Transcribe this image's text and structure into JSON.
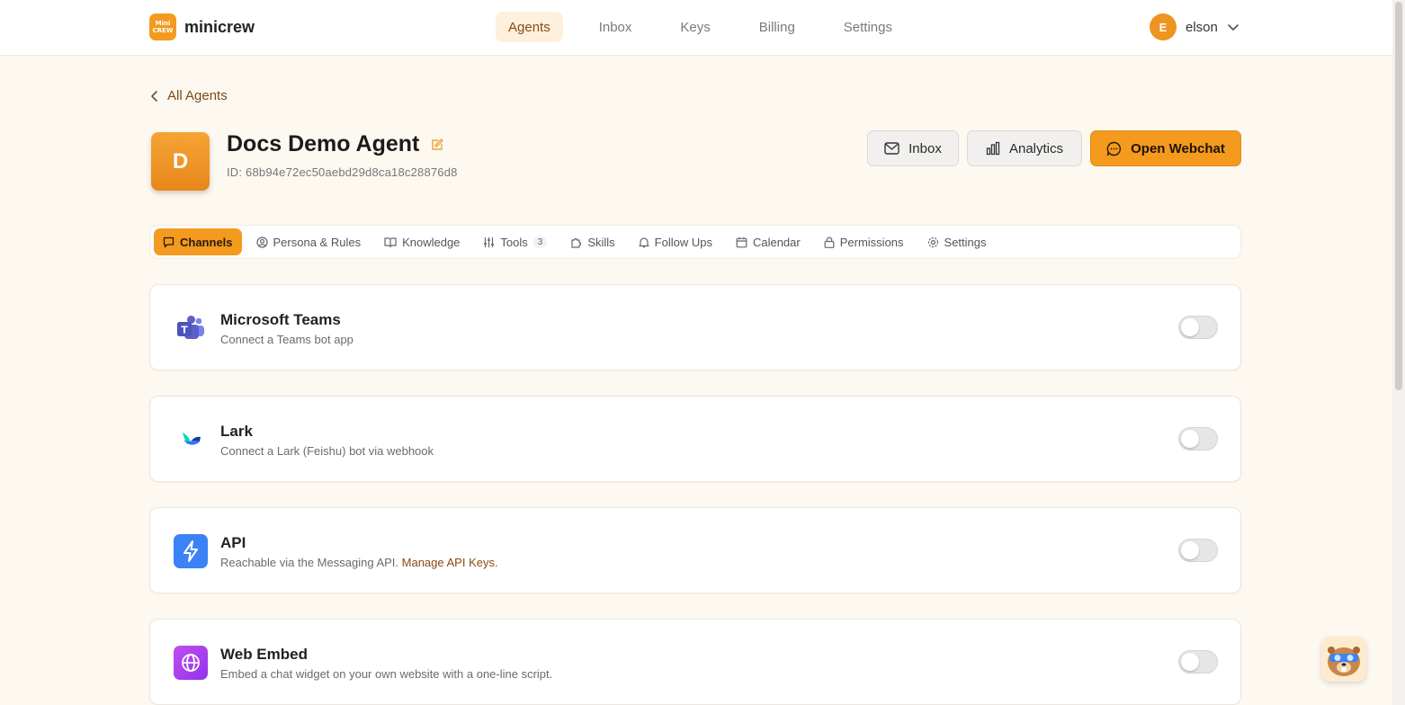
{
  "app": {
    "logo_mark_top": "Mini",
    "logo_mark_bottom": "CREW",
    "name": "minicrew"
  },
  "nav": {
    "items": [
      {
        "label": "Agents",
        "active": true
      },
      {
        "label": "Inbox"
      },
      {
        "label": "Keys"
      },
      {
        "label": "Billing"
      },
      {
        "label": "Settings"
      }
    ]
  },
  "user": {
    "initial": "E",
    "name": "elson"
  },
  "back": {
    "label": "All Agents"
  },
  "agent": {
    "initial": "D",
    "name": "Docs Demo Agent",
    "id_label": "ID: 68b94e72ec50aebd29d8ca18c28876d8"
  },
  "actions": {
    "inbox": "Inbox",
    "analytics": "Analytics",
    "open_webchat": "Open Webchat"
  },
  "tabs": [
    {
      "label": "Channels",
      "icon": "chat-icon",
      "active": true
    },
    {
      "label": "Persona & Rules",
      "icon": "user-circle-icon"
    },
    {
      "label": "Knowledge",
      "icon": "book-icon"
    },
    {
      "label": "Tools",
      "icon": "sliders-icon",
      "badge": "3"
    },
    {
      "label": "Skills",
      "icon": "puzzle-icon"
    },
    {
      "label": "Follow Ups",
      "icon": "bell-icon"
    },
    {
      "label": "Calendar",
      "icon": "calendar-icon"
    },
    {
      "label": "Permissions",
      "icon": "lock-icon"
    },
    {
      "label": "Settings",
      "icon": "gear-icon"
    }
  ],
  "channels": [
    {
      "title": "Microsoft Teams",
      "desc": "Connect a Teams bot app",
      "icon": "teams-icon",
      "enabled": false
    },
    {
      "title": "Lark",
      "desc": "Connect a Lark (Feishu) bot via webhook",
      "icon": "lark-icon",
      "enabled": false
    },
    {
      "title": "API",
      "desc": "Reachable via the Messaging API.",
      "link": "Manage API Keys.",
      "icon": "lightning-icon",
      "enabled": false
    },
    {
      "title": "Web Embed",
      "desc": "Embed a chat widget on your own website with a one-line script.",
      "icon": "globe-icon",
      "enabled": false
    }
  ],
  "colors": {
    "accent": "#f39a1f",
    "background": "#fdf8f0",
    "teams": "#5b5fc7",
    "api": "#3b82f6",
    "web_embed": "#a855f7"
  }
}
